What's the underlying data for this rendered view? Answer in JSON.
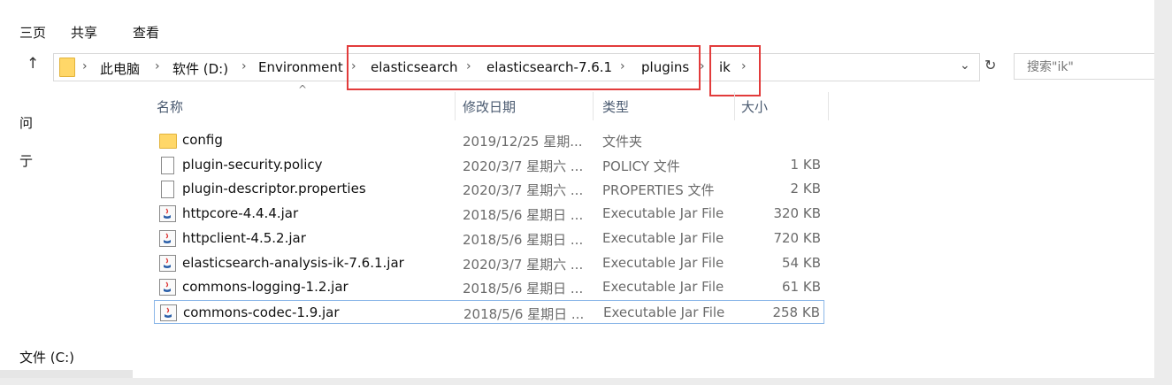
{
  "ribbon": {
    "tabs": [
      "主页",
      "共享",
      "查看"
    ],
    "first_tab_visible": "三页"
  },
  "address": {
    "crumbs": [
      "此电脑",
      "软件 (D:)",
      "Environment",
      "elasticsearch",
      "elasticsearch-7.6.1",
      "plugins",
      "ik"
    ],
    "dropdown_icon": "chevron-down-icon",
    "refresh_icon": "refresh-icon",
    "search_placeholder": "搜索\"ik\"",
    "highlight_color": "#e23b3b"
  },
  "nav": {
    "item1": "问",
    "item2": "亍",
    "item3": "文件 (C:)"
  },
  "columns": {
    "name": "名称",
    "date": "修改日期",
    "type": "类型",
    "size": "大小"
  },
  "files": [
    {
      "name": "config",
      "date": "2019/12/25 星期...",
      "type": "文件夹",
      "size": "",
      "icon": "folder-icon"
    },
    {
      "name": "plugin-security.policy",
      "date": "2020/3/7 星期六 ...",
      "type": "POLICY 文件",
      "size": "1 KB",
      "icon": "document-icon"
    },
    {
      "name": "plugin-descriptor.properties",
      "date": "2020/3/7 星期六 ...",
      "type": "PROPERTIES 文件",
      "size": "2 KB",
      "icon": "document-icon"
    },
    {
      "name": "httpcore-4.4.4.jar",
      "date": "2018/5/6 星期日 ...",
      "type": "Executable Jar File",
      "size": "320 KB",
      "icon": "jar-icon"
    },
    {
      "name": "httpclient-4.5.2.jar",
      "date": "2018/5/6 星期日 ...",
      "type": "Executable Jar File",
      "size": "720 KB",
      "icon": "jar-icon"
    },
    {
      "name": "elasticsearch-analysis-ik-7.6.1.jar",
      "date": "2020/3/7 星期六 ...",
      "type": "Executable Jar File",
      "size": "54 KB",
      "icon": "jar-icon"
    },
    {
      "name": "commons-logging-1.2.jar",
      "date": "2018/5/6 星期日 ...",
      "type": "Executable Jar File",
      "size": "61 KB",
      "icon": "jar-icon"
    },
    {
      "name": "commons-codec-1.9.jar",
      "date": "2018/5/6 星期日 ...",
      "type": "Executable Jar File",
      "size": "258 KB",
      "icon": "jar-icon",
      "selected": true
    }
  ]
}
